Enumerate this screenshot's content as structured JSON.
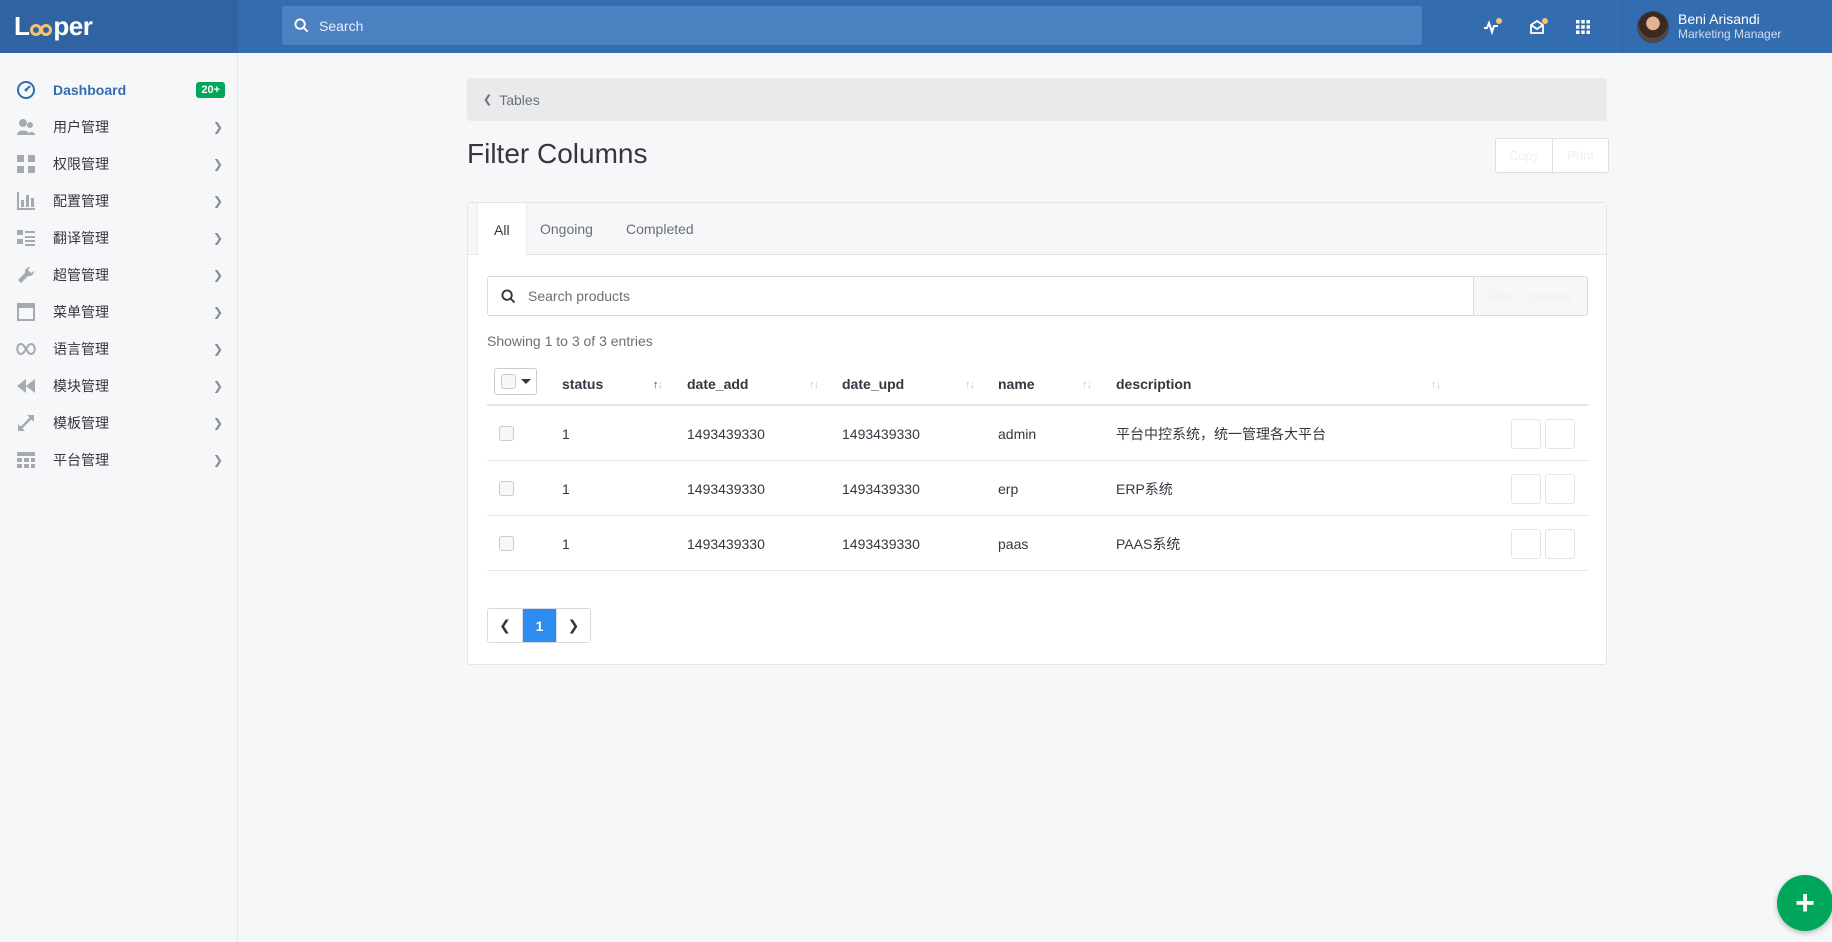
{
  "brand": {
    "name_pre": "L",
    "name_post": "per"
  },
  "topbar": {
    "search_placeholder": "Search",
    "icons": [
      "activity-icon",
      "inbox-icon",
      "apps-grid-icon"
    ]
  },
  "user": {
    "name": "Beni Arisandi",
    "role": "Marketing Manager"
  },
  "sidebar": {
    "items": [
      {
        "label": "Dashboard",
        "badge": "20+",
        "icon": "dashboard-icon",
        "active": true
      },
      {
        "label": "用户管理",
        "icon": "users-icon"
      },
      {
        "label": "权限管理",
        "icon": "grid-icon"
      },
      {
        "label": "配置管理",
        "icon": "bar-chart-icon"
      },
      {
        "label": "翻译管理",
        "icon": "list-icon"
      },
      {
        "label": "超管管理",
        "icon": "wrench-icon"
      },
      {
        "label": "菜单管理",
        "icon": "window-icon"
      },
      {
        "label": "语言管理",
        "icon": "infinity-icon"
      },
      {
        "label": "模块管理",
        "icon": "rewind-icon"
      },
      {
        "label": "模板管理",
        "icon": "expand-icon"
      },
      {
        "label": "平台管理",
        "icon": "table-icon"
      }
    ]
  },
  "breadcrumb": {
    "label": "Tables"
  },
  "page": {
    "title": "Filter Columns",
    "btn_copy": "Copy",
    "btn_print": "Print"
  },
  "tabs": [
    {
      "label": "All",
      "active": true
    },
    {
      "label": "Ongoing"
    },
    {
      "label": "Completed"
    }
  ],
  "search": {
    "placeholder": "Search products",
    "filter_label": "Filter Columns"
  },
  "entries_text": "Showing 1 to 3 of 3 entries",
  "table": {
    "columns": [
      "status",
      "date_add",
      "date_upd",
      "name",
      "description"
    ],
    "rows": [
      [
        "1",
        "1493439330",
        "1493439330",
        "admin",
        "平台中控系统，统一管理各大平台"
      ],
      [
        "1",
        "1493439330",
        "1493439330",
        "erp",
        "ERP系统"
      ],
      [
        "1",
        "1493439330",
        "1493439330",
        "paas",
        "PAAS系统"
      ]
    ]
  },
  "pagination": {
    "current": "1"
  },
  "colors": {
    "primary": "#346cb0",
    "success": "#00a65a",
    "page_active": "#2d8cf0"
  }
}
